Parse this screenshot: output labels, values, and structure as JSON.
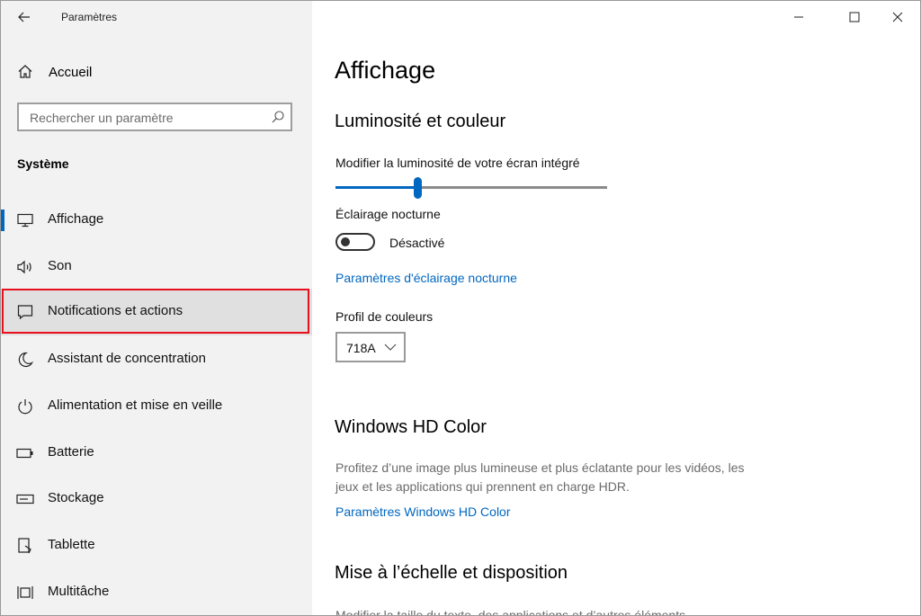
{
  "app": {
    "title": "Paramètres"
  },
  "sidebar": {
    "home_label": "Accueil",
    "search_placeholder": "Rechercher un paramètre",
    "section_title": "Système",
    "items": [
      {
        "label": "Affichage",
        "icon": "monitor-icon",
        "selected": true
      },
      {
        "label": "Son",
        "icon": "speaker-icon"
      },
      {
        "label": "Notifications et actions",
        "icon": "notification-icon",
        "highlighted": true
      },
      {
        "label": "Assistant de concentration",
        "icon": "moon-icon"
      },
      {
        "label": "Alimentation et mise en veille",
        "icon": "power-icon"
      },
      {
        "label": "Batterie",
        "icon": "battery-icon"
      },
      {
        "label": "Stockage",
        "icon": "storage-icon"
      },
      {
        "label": "Tablette",
        "icon": "tablet-icon"
      },
      {
        "label": "Multitâche",
        "icon": "multitask-icon"
      }
    ]
  },
  "main": {
    "page_title": "Affichage",
    "brightness": {
      "heading": "Luminosité et couleur",
      "slider_label": "Modifier la luminosité de votre écran intégré",
      "level_fraction": 0.3
    },
    "night_light": {
      "label": "Éclairage nocturne",
      "state": "Désactivé",
      "settings_link": "Paramètres d'éclairage nocturne"
    },
    "color_profile": {
      "label": "Profil de couleurs",
      "value": "718A"
    },
    "hd_color": {
      "heading": "Windows HD Color",
      "description": "Profitez d’une image plus lumineuse et plus éclatante pour les vidéos, les jeux et les applications qui prennent en charge HDR.",
      "link": "Paramètres Windows HD Color"
    },
    "scale": {
      "heading": "Mise à l’échelle et disposition",
      "description": "Modifier la taille du texte, des applications et d’autres éléments"
    }
  },
  "colors": {
    "accent": "#0067c0",
    "highlight_border": "#e8101e"
  }
}
